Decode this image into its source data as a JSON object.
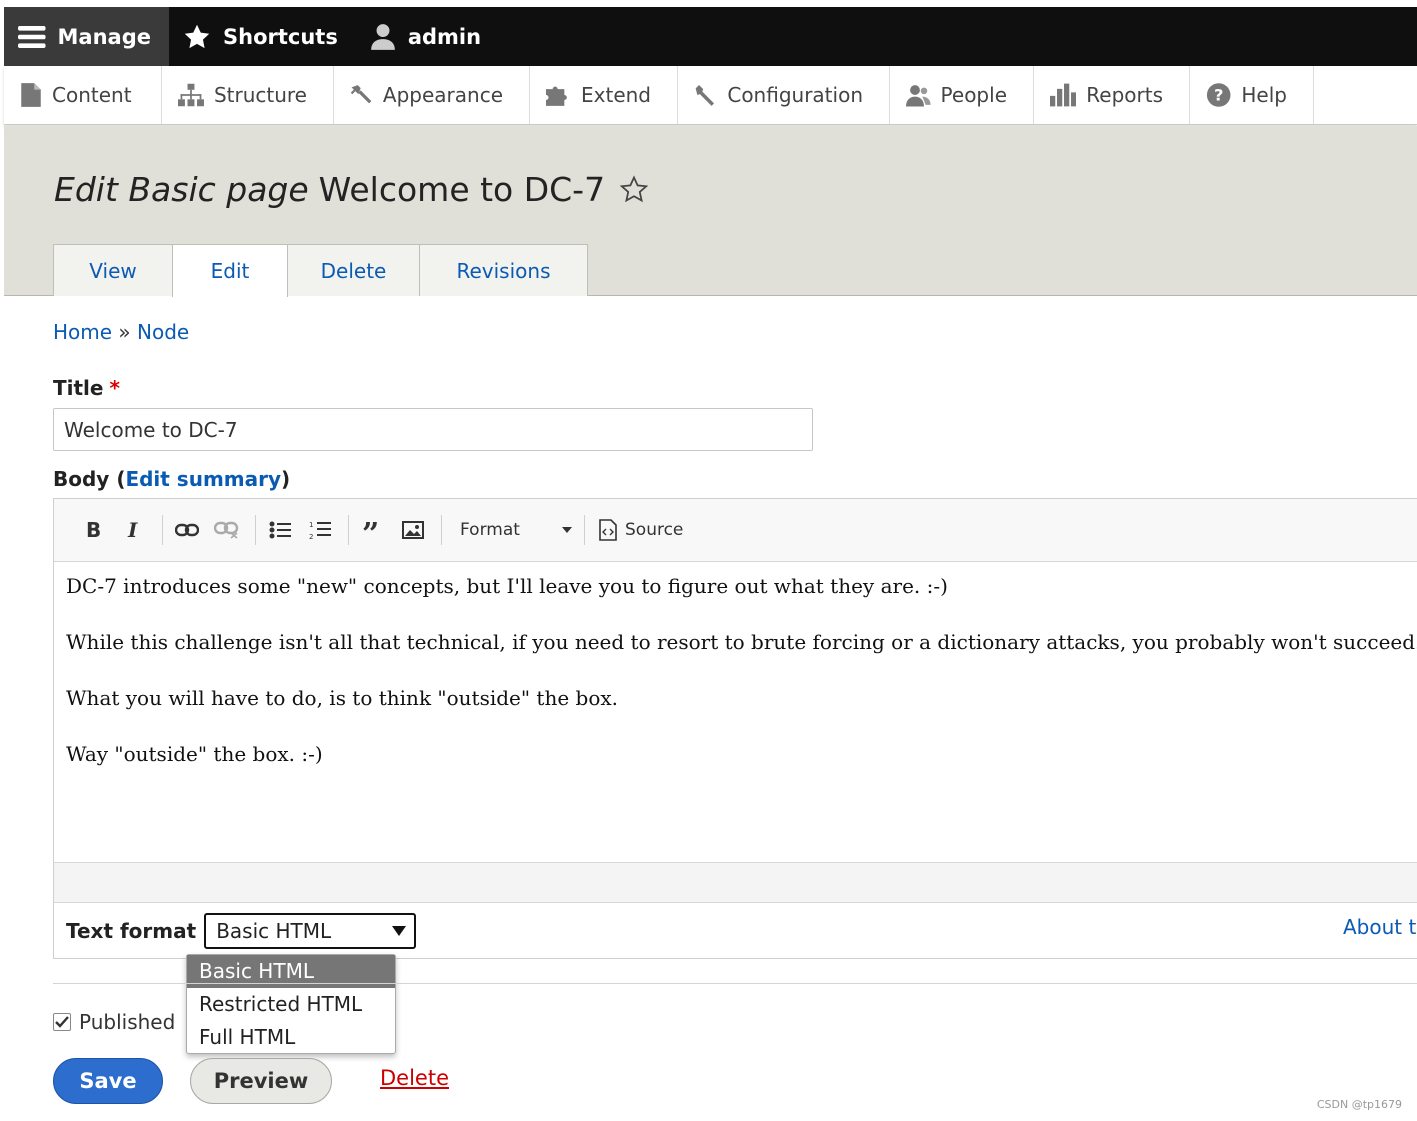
{
  "toolbar": {
    "manage": "Manage",
    "shortcuts": "Shortcuts",
    "user": "admin"
  },
  "tray": {
    "items": [
      "Content",
      "Structure",
      "Appearance",
      "Extend",
      "Configuration",
      "People",
      "Reports",
      "Help"
    ]
  },
  "page": {
    "title_type": "Edit Basic page",
    "title_name": "Welcome to DC-7",
    "tabs": [
      "View",
      "Edit",
      "Delete",
      "Revisions"
    ],
    "active_tab": "Edit"
  },
  "breadcrumb": {
    "home": "Home",
    "sep": "»",
    "node": "Node"
  },
  "form": {
    "title_label": "Title",
    "title_required": "*",
    "title_value": "Welcome to DC-7",
    "body_label": "Body",
    "body_paren_open": "(",
    "edit_summary": "Edit summary",
    "body_paren_close": ")",
    "editor_toolbar": {
      "format": "Format",
      "source": "Source"
    },
    "body_paragraphs": [
      "DC-7 introduces some \"new\" concepts, but I'll leave you to figure out what they are.  :-)",
      "While this challenge isn't all that technical, if you need to resort to brute forcing or a dictionary attacks, you probably won't succeed.",
      "What you will have to do, is to think \"outside\" the box.",
      "Way \"outside\" the box.  :-)"
    ],
    "text_format_label": "Text format",
    "text_format_selected": "Basic HTML",
    "text_format_options": [
      "Basic HTML",
      "Restricted HTML",
      "Full HTML"
    ],
    "about_link": "About text formats",
    "published_label": "Published",
    "published_checked": true
  },
  "actions": {
    "save": "Save",
    "preview": "Preview",
    "delete": "Delete"
  },
  "watermark": "CSDN @tp1679",
  "colors": {
    "toolbar_bg": "#0f0f0f",
    "link": "#0b5ab3",
    "primary": "#2c6dcd",
    "danger": "#c00000"
  }
}
